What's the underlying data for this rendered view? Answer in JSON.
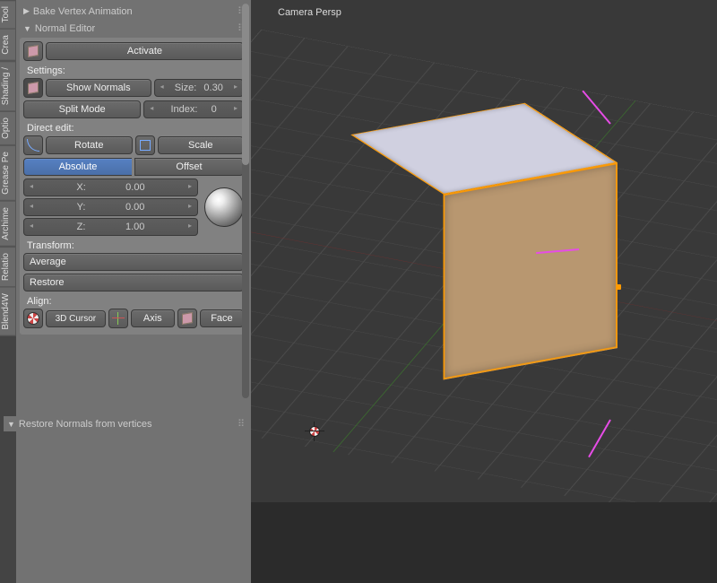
{
  "vtabs": [
    "Tool",
    "Crea",
    "Shading /",
    "Optio",
    "Grease Pe",
    "Archime",
    "Relatio",
    "Blend4W"
  ],
  "panels": {
    "bake": {
      "title": "Bake Vertex Animation",
      "collapsed": true
    },
    "normal": {
      "title": "Normal Editor",
      "activate": "Activate",
      "settings_label": "Settings:",
      "show_normals": "Show Normals",
      "size_label": "Size:",
      "size_value": "0.30",
      "split_mode": "Split Mode",
      "index_label": "Index:",
      "index_value": "0",
      "direct_edit_label": "Direct edit:",
      "rotate": "Rotate",
      "scale": "Scale",
      "absolute": "Absolute",
      "offset": "Offset",
      "x_label": "X:",
      "x_value": "0.00",
      "y_label": "Y:",
      "y_value": "0.00",
      "z_label": "Z:",
      "z_value": "1.00",
      "transform_label": "Transform:",
      "average": "Average",
      "restore": "Restore",
      "align_label": "Align:",
      "cursor3d": "3D Cursor",
      "axis": "Axis",
      "face": "Face"
    },
    "restore_normals": {
      "title": "Restore Normals from vertices"
    }
  },
  "viewport": {
    "label": "Camera Persp"
  }
}
